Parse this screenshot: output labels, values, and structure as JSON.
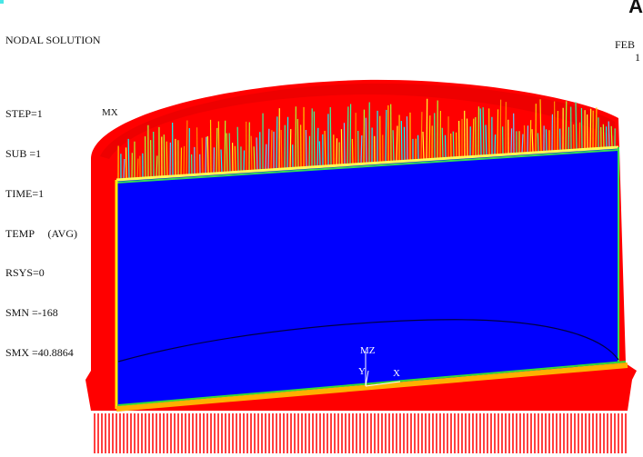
{
  "title": "NODAL SOLUTION",
  "solution_info": [
    "STEP=1",
    "SUB =1",
    "TIME=1",
    "TEMP     (AVG)",
    "RSYS=0",
    "SMN =-168",
    "SMX =40.8864"
  ],
  "corner_logo": "A",
  "date": {
    "month": "FEB",
    "day": "1"
  },
  "max_marker": "MX",
  "triad": {
    "z": "Z",
    "y": "Y",
    "x": "X",
    "y2": "Y"
  },
  "colors": {
    "hot": "#ff0000",
    "cold": "#0000ff",
    "background": "#ffffff",
    "edge_orange": "#ffb000",
    "edge_yellow": "#ffee00",
    "edge_green": "#33dd33",
    "corner_dot": "#49e6e6"
  }
}
